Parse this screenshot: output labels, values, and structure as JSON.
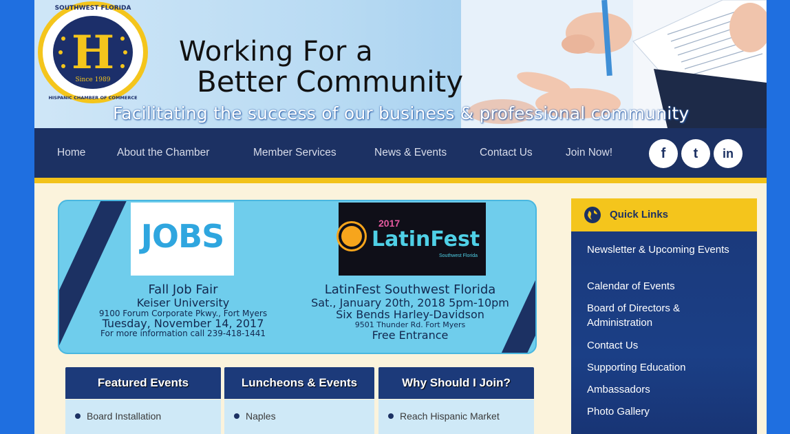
{
  "header": {
    "logo": {
      "arc_top": "SOUTHWEST FLORIDA",
      "letter": "H",
      "since": "Since 1989",
      "arc_bottom": "HISPANIC CHAMBER OF COMMERCE"
    },
    "tagline_line1": "Working For a",
    "tagline_line2": "Better Community",
    "subtagline": "Facilitating the success of our business & professional community"
  },
  "nav": {
    "items": [
      {
        "label": "Home"
      },
      {
        "label": "About the Chamber"
      },
      {
        "label": "Member Services"
      },
      {
        "label": "News & Events"
      },
      {
        "label": "Contact Us"
      },
      {
        "label": "Join Now!"
      }
    ],
    "social": [
      {
        "icon": "facebook-icon",
        "glyph": "f"
      },
      {
        "icon": "twitter-icon",
        "glyph": "t"
      },
      {
        "icon": "linkedin-icon",
        "glyph": "in"
      }
    ]
  },
  "banner": {
    "jobs_image_text": "JOBS",
    "latin_image": {
      "year": "2017",
      "title": "LatinFest",
      "sub": "Southwest Florida"
    },
    "event1": {
      "title": "Fall Job Fair",
      "venue": "Keiser University",
      "address": "9100 Forum Corporate Pkwy., Fort Myers",
      "date": "Tuesday, November 14, 2017",
      "info": "For more information call 239-418-1441"
    },
    "event2": {
      "title": "LatinFest Southwest Florida",
      "date": "Sat., January 20th, 2018  5pm-10pm",
      "venue": "Six Bends Harley-Davidson",
      "address": "9501 Thunder Rd. Fort Myers",
      "price": "Free Entrance"
    }
  },
  "columns": [
    {
      "heading": "Featured Events",
      "first_item": "Board Installation"
    },
    {
      "heading": "Luncheons & Events",
      "first_item": "Naples"
    },
    {
      "heading": "Why Should I Join?",
      "first_item": "Reach Hispanic Market"
    }
  ],
  "quick_links": {
    "title": "Quick Links",
    "items": [
      "Newsletter & Upcoming Events",
      "Calendar of Events",
      "Board of Directors & Administration",
      "Contact Us",
      "Supporting Education",
      "Ambassadors",
      "Photo Gallery"
    ]
  },
  "colors": {
    "navy": "#1c3163",
    "gold": "#f2c21a",
    "outer_blue": "#1f6fe0",
    "banner_cyan": "#6fcdec"
  }
}
